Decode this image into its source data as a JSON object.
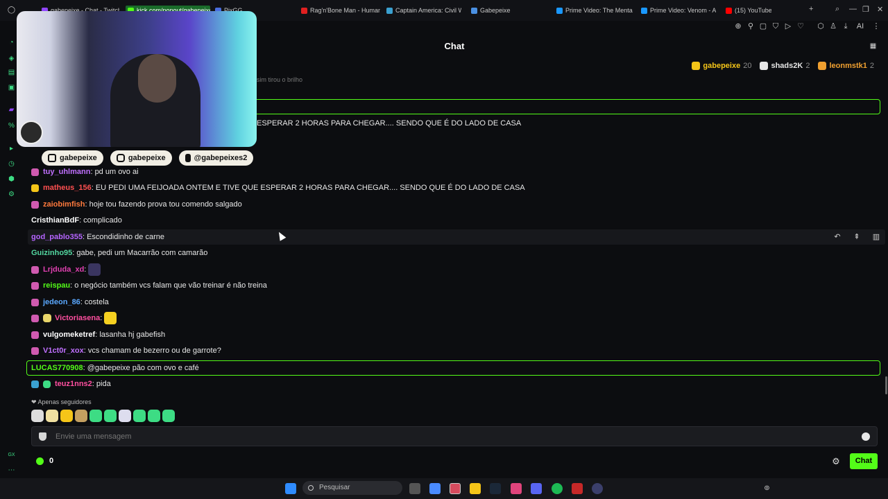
{
  "browser": {
    "tabs": [
      {
        "label": "gabepeixe - Chat - Twitch",
        "color": "#9146ff"
      },
      {
        "label": "kick.com/popout/gabepeixe",
        "color": "#53fc18",
        "active": true
      },
      {
        "label": "PixGG",
        "color": "#4a6ee0"
      },
      {
        "label": "Rag'n'Bone Man - Human",
        "color": "#e02020"
      },
      {
        "label": "Captain America: Civil War",
        "color": "#3aa0d0"
      },
      {
        "label": "Gabepeixe",
        "color": "#4a90e2"
      },
      {
        "label": "Prime Video: The Mentalist",
        "color": "#1a98ff"
      },
      {
        "label": "Prime Video: Venom - A",
        "color": "#1a98ff"
      },
      {
        "label": "(15) YouTube",
        "color": "#ff0000"
      }
    ],
    "ai_label": "AI"
  },
  "chat": {
    "title": "Chat",
    "leaderboard": [
      {
        "name": "gabepeixe",
        "count": "20",
        "color": "#f5c518"
      },
      {
        "name": "shads2K",
        "count": "2",
        "color": "#e6e6e6"
      },
      {
        "name": "leonmstk1",
        "count": "2",
        "color": "#f0a030"
      }
    ],
    "sub_line": "sim tirou o brilho",
    "socials": [
      "gabepeixe",
      "gabepeixe",
      "@gabepeixes2"
    ],
    "messages": [
      {
        "user": "",
        "text": "ESPERAR 2 HORAS PARA CHEGAR.... SENDO QUE É DO LADO DE CASA",
        "color": "#ff6a6a"
      },
      {
        "user": "tuy_uhlmann",
        "text": ": pd um ovo ai",
        "color": "#c070ff",
        "badge": "#d05ab0"
      },
      {
        "user": "matheus_156",
        "text": ": EU PEDI UMA FEIJOADA ONTEM E TIVE QUE ESPERAR 2 HORAS PARA CHEGAR.... SENDO QUE É DO LADO DE CASA",
        "color": "#ff5050",
        "badge": "#f5c518"
      },
      {
        "user": "zaiobimfish",
        "text": ": hoje tou fazendo prova tou comendo salgado",
        "color": "#ff7a3d",
        "badge": "#d05ab0"
      },
      {
        "user": "CristhianBdF",
        "text": ": complicado",
        "color": "#ffffff"
      },
      {
        "user": "god_pablo355",
        "text": ": Escondidinho de carne",
        "color": "#b565ff"
      },
      {
        "user": "Guizinho95",
        "text": ": gabe, pedi um Macarrão com camarão",
        "color": "#53d7a0"
      },
      {
        "user": "Lrjduda_xd",
        "text": ":",
        "color": "#e040b0",
        "badge": "#d05ab0"
      },
      {
        "user": "reispau",
        "text": ": o negócio também vcs falam que vão treinar é não treina",
        "color": "#53fc18",
        "badge": "#d05ab0"
      },
      {
        "user": "jedeon_86",
        "text": ": costela",
        "color": "#5aa8ff",
        "badge": "#d05ab0"
      },
      {
        "user": "Victoriasena",
        "text": ":",
        "color": "#ff4fa0",
        "badge": "#d05ab0"
      },
      {
        "user": "vulgomeketref",
        "text": ": lasanha hj gabefish",
        "color": "#ffffff",
        "badge": "#d05ab0"
      },
      {
        "user": "V1ct0r_xox",
        "text": ": vcs chamam de bezerro ou de garrote?",
        "color": "#c070ff",
        "badge": "#d05ab0"
      },
      {
        "user": "LUCAS770908",
        "text": ": @gabepeixe pão com ovo e café",
        "color": "#53fc18"
      },
      {
        "user": "teuz1nns2",
        "text": ": pida",
        "color": "#ff4fa0",
        "badge": "#3aa0d0"
      }
    ],
    "followers_only": "Apenas seguidores",
    "input_placeholder": "Envie uma mensagem",
    "counter": "0",
    "send_label": "Chat"
  },
  "taskbar": {
    "search_placeholder": "Pesquisar"
  }
}
